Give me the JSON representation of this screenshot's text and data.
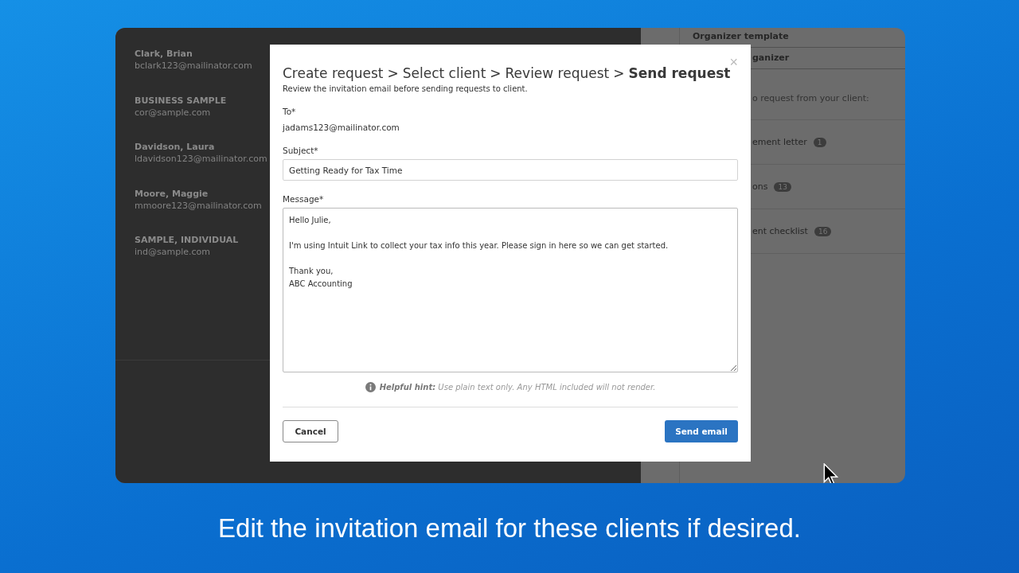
{
  "clients": [
    {
      "name": "Clark, Brian",
      "email": "bclark123@mailinator.com"
    },
    {
      "name": "BUSINESS SAMPLE",
      "email": "cor@sample.com"
    },
    {
      "name": "Davidson, Laura",
      "email": "ldavidson123@mailinator.com"
    },
    {
      "name": "Moore, Maggie",
      "email": "mmoore123@mailinator.com"
    },
    {
      "name": "SAMPLE, INDIVIDUAL",
      "email": "ind@sample.com"
    }
  ],
  "right_panel": {
    "header": "Organizer template",
    "subheader": "ganizer",
    "prompt": "o request from your client:",
    "items": [
      {
        "label": "ement letter",
        "count": "1"
      },
      {
        "label": "ons",
        "count": "13"
      },
      {
        "label": "ent checklist",
        "count": "16"
      }
    ]
  },
  "dialog": {
    "breadcrumb": [
      "Create request",
      "Select client",
      "Review request",
      "Send request"
    ],
    "separator": ">",
    "close": "×",
    "subtitle": "Review the invitation email before sending requests to client.",
    "to_label": "To*",
    "to_value": "jadams123@mailinator.com",
    "subject_label": "Subject*",
    "subject_value": "Getting Ready for Tax Time",
    "message_label": "Message*",
    "message_paragraphs": [
      [
        "Hello Julie,"
      ],
      [
        "I'm using Intuit Link to collect your tax info this year. Please sign in here so we can get started."
      ],
      [
        "Thank you,",
        "ABC Accounting"
      ]
    ],
    "hint": "**Helpful hint:** Use plain text only. Any HTML included will not render.",
    "buttons": [
      {
        "label": "Cancel",
        "kind": "secondary"
      },
      {
        "label": "Send email",
        "kind": "primary"
      }
    ]
  },
  "caption": "Edit the invitation email for these clients if desired."
}
